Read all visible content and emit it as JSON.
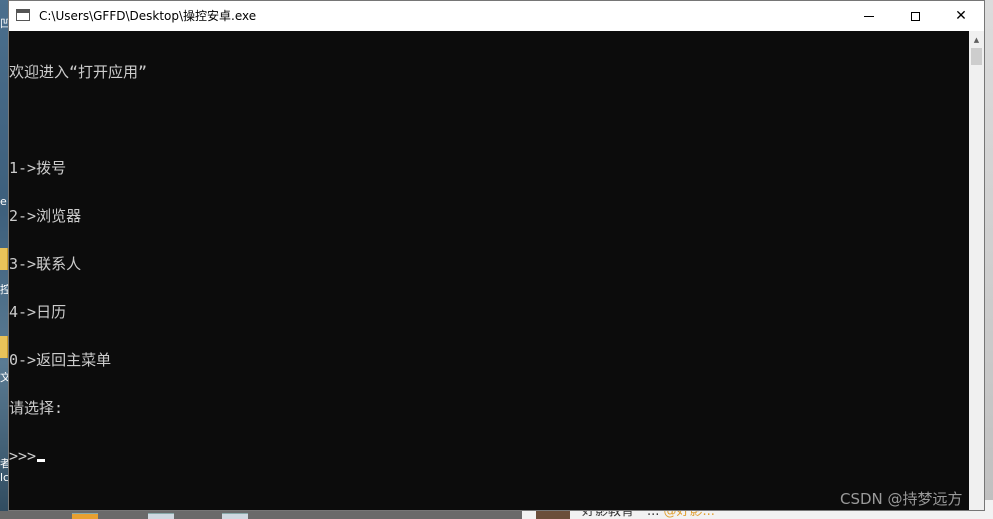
{
  "window": {
    "title": "C:\\Users\\GFFD\\Desktop\\操控安卓.exe",
    "app_icon": "console-window-icon",
    "controls": {
      "minimize_icon": "minimize-icon",
      "maximize_icon": "maximize-icon",
      "close_icon": "close-icon",
      "close_glyph": "✕"
    }
  },
  "console": {
    "lines": [
      "欢迎进入“打开应用”",
      "",
      "1->拨号",
      "2->浏览器",
      "3->联系人",
      "4->日历",
      "0->返回主菜单",
      "请选择:",
      ">>>"
    ],
    "text_color": "#cccccc",
    "background": "#0c0c0c"
  },
  "scrollbar": {
    "up_arrow": "▲"
  },
  "desktop_peek": {
    "left_glyphs": [
      "凹",
      "e",
      "控",
      "文",
      "者",
      "lc"
    ],
    "bottom_text_prefix": "好影教育一...",
    "bottom_text_mention": "@好影..."
  },
  "watermark": "CSDN @持梦远方"
}
